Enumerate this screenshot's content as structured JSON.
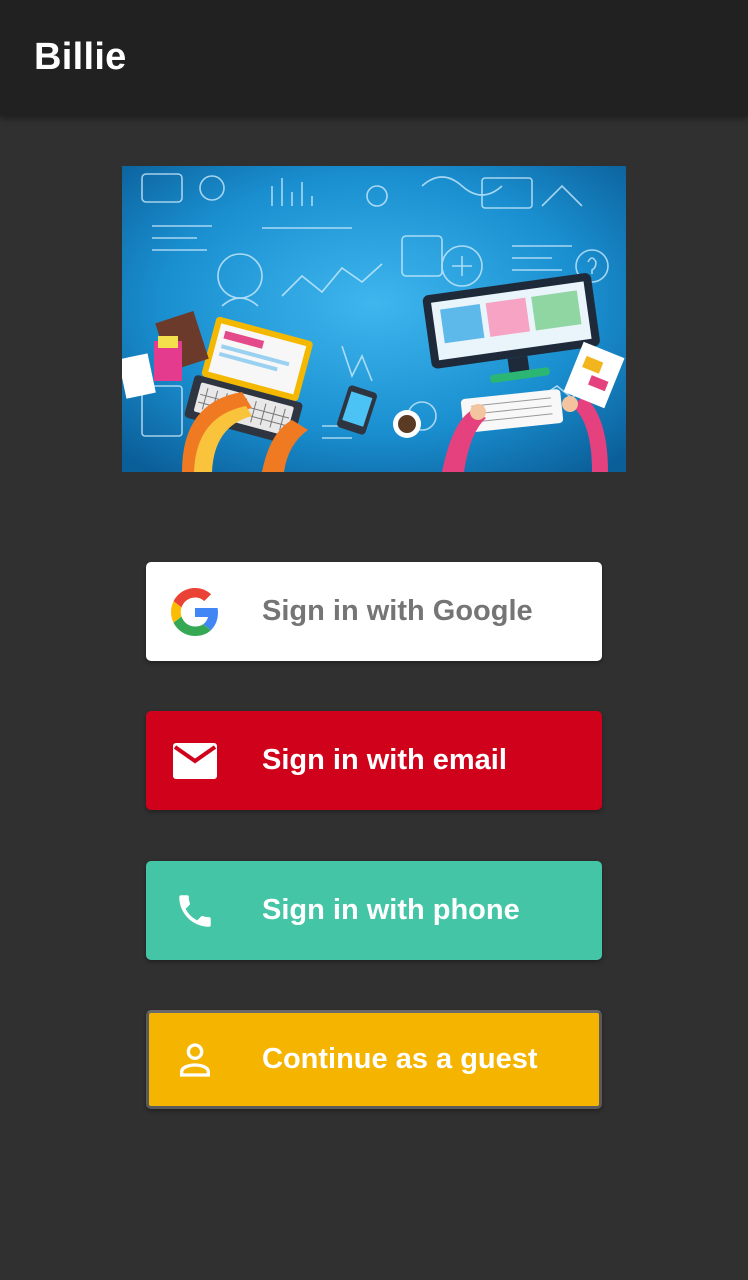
{
  "appbar": {
    "title": "Billie"
  },
  "hero": {
    "image": "business-workspace-illustration"
  },
  "buttons": {
    "google": {
      "label": "Sign in with Google",
      "icon": "google-g-icon",
      "bg": "#ffffff",
      "fg": "#757575"
    },
    "email": {
      "label": "Sign in with email",
      "icon": "mail-icon",
      "bg": "#d0021b",
      "fg": "#ffffff"
    },
    "phone": {
      "label": "Sign in with phone",
      "icon": "phone-icon",
      "bg": "#44c5a5",
      "fg": "#ffffff"
    },
    "guest": {
      "label": "Continue as a guest",
      "icon": "person-icon",
      "bg": "#f4b400",
      "fg": "#ffffff"
    }
  },
  "colors": {
    "background": "#303030",
    "appbar": "#212121"
  }
}
